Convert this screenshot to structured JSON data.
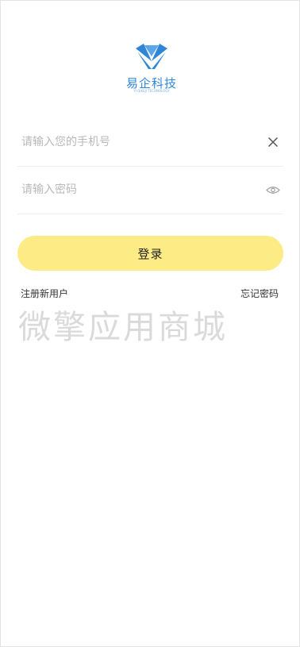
{
  "brand": {
    "name": "易企科技",
    "tagline": "YI QIKEJI TECHNOLOGY",
    "color": "#2f86d8"
  },
  "form": {
    "phone_placeholder": "请输入您的手机号",
    "password_placeholder": "请输入密码"
  },
  "actions": {
    "login_label": "登录",
    "register_label": "注册新用户",
    "forgot_label": "忘记密码"
  },
  "watermark": "微擎应用商城",
  "colors": {
    "button_bg": "#fdec86",
    "placeholder": "#b9b9b9",
    "divider": "#eeeeee"
  }
}
